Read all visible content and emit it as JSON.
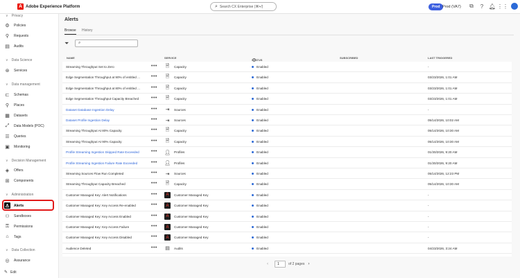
{
  "app": {
    "title": "Adobe Experience Platform",
    "logo": "A"
  },
  "topbar": {
    "search_placeholder": "Search CX Enterprise (⌘+/)",
    "env_badge": "Prod",
    "sandbox": "Prod (VA7)",
    "icons": [
      "notifications-icon",
      "help-icon",
      "bell-icon",
      "apps-grid-icon"
    ],
    "avatar": ""
  },
  "sidebar": {
    "sections": {
      "privacy": "Privacy",
      "data_science": "Data Science",
      "data_management": "Data management",
      "decision_management": "Decision Management",
      "administration": "Administration",
      "data_collection": "Data Collection"
    },
    "items": {
      "policies": "Policies",
      "requests": "Requests",
      "audits": "Audits",
      "services": "Services",
      "schemas": "Schemas",
      "places": "Places",
      "datasets": "Datasets",
      "queries": "Queries",
      "data_models": "Data Models (POC)",
      "monitoring": "Monitoring",
      "offers": "Offers",
      "components": "Components",
      "alerts": "Alerts",
      "sandboxes": "Sandboxes",
      "permissions": "Permissions",
      "tags": "Tags",
      "assurance": "Assurance"
    },
    "edit_label": "Edit"
  },
  "main": {
    "title": "Alerts",
    "tabs": [
      "Browse",
      "History"
    ],
    "search_placeholder": "",
    "columns": {
      "name": "NAME",
      "service": "SERVICE",
      "status": "STATUS",
      "subscribed": "SUBSCRIBED",
      "last_triggered": "LAST TRIGGERED"
    },
    "rows": [
      {
        "name": "Streaming Throughput Set to Zero",
        "service": "Capacity",
        "status": "Enabled",
        "last": "-"
      },
      {
        "name": "Edge Segmentation Throughput at 90% of entitled ...",
        "service": "Capacity",
        "status": "Enabled",
        "last": "03/23/2026, 1:01 AM"
      },
      {
        "name": "Edge Segmentation Throughput at 80% of entitled ...",
        "service": "Capacity",
        "status": "Enabled",
        "last": "03/23/2026, 1:01 AM"
      },
      {
        "name": "Edge Segmentation Throughput Capacity Breached",
        "service": "Capacity",
        "status": "Enabled",
        "last": "03/23/2026, 1:01 AM"
      },
      {
        "name": "Dataset Database Ingestion Delay",
        "service": "Sources",
        "status": "Enabled",
        "last": "-"
      },
      {
        "name": "Dataset Profile Ingestion Delay",
        "service": "Sources",
        "status": "Enabled",
        "last": "05/14/2026, 10:02 AM"
      },
      {
        "name": "Streaming Throughput At 80% Capacity",
        "service": "Capacity",
        "status": "Enabled",
        "last": "05/14/2026, 10:30 AM"
      },
      {
        "name": "Streaming Throughput At 90% Capacity",
        "service": "Capacity",
        "status": "Enabled",
        "last": "05/14/2026, 10:30 AM"
      },
      {
        "name": "Profile Streaming Ingestion Skipped Rate Exceeded",
        "service": "Profiles",
        "status": "Enabled",
        "last": "01/30/2026, 9:20 AM"
      },
      {
        "name": "Profile Streaming Ingestion Failure Rate Exceeded",
        "service": "Profiles",
        "status": "Enabled",
        "last": "01/30/2026, 9:20 AM"
      },
      {
        "name": "Streaming Sources Flow Run Completed",
        "service": "Sources",
        "status": "Enabled",
        "last": "05/14/2026, 12:23 PM"
      },
      {
        "name": "Streaming Throughput Capacity Breached",
        "service": "Capacity",
        "status": "Enabled",
        "last": "05/14/2026, 10:30 AM"
      },
      {
        "name": "Customer Managed Key: Alert Notifications",
        "service": "Customer Managed Key",
        "status": "Enabled",
        "last": "-"
      },
      {
        "name": "Customer Managed Key: Key Access Re-enabled",
        "service": "Customer Managed Key",
        "status": "Enabled",
        "last": "-"
      },
      {
        "name": "Customer Managed Key: Key Access Enabled",
        "service": "Customer Managed Key",
        "status": "Enabled",
        "last": "-"
      },
      {
        "name": "Customer Managed Key: Key Access Failure",
        "service": "Customer Managed Key",
        "status": "Enabled",
        "last": "-"
      },
      {
        "name": "Customer Managed Key: Key Access Disabled",
        "service": "Customer Managed Key",
        "status": "Enabled",
        "last": "-"
      },
      {
        "name": "Audience Deleted",
        "service": "Audits",
        "status": "Enabled",
        "last": "04/23/2026, 3:24 AM"
      }
    ],
    "link_rows": [
      4,
      5,
      8,
      9
    ]
  },
  "pagination": {
    "current": "1",
    "total_label": "of 2 pages",
    "prev": "‹",
    "next": "›"
  }
}
